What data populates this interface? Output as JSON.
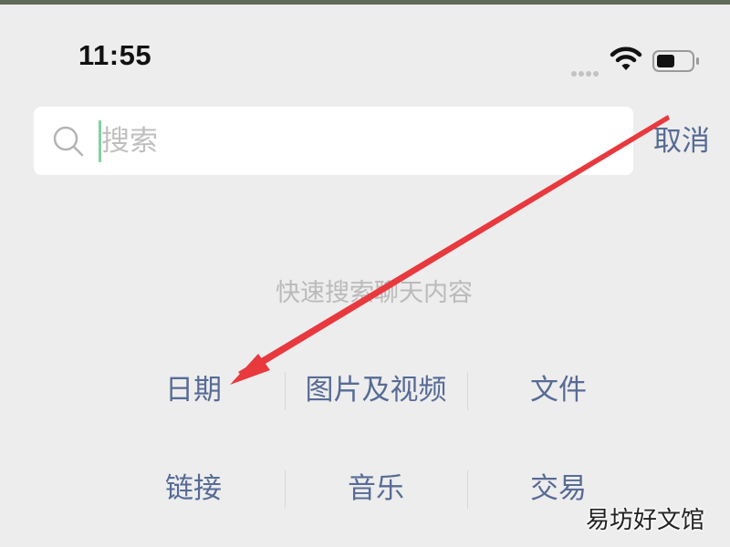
{
  "status_bar": {
    "time": "11:55",
    "icons": [
      "signal-dots-icon",
      "wifi-icon",
      "battery-icon"
    ]
  },
  "search": {
    "placeholder": "搜索",
    "value": "",
    "cancel_label": "取消"
  },
  "hint": "快速搜索聊天内容",
  "categories": [
    [
      "日期",
      "图片及视频",
      "文件"
    ],
    [
      "链接",
      "音乐",
      "交易"
    ]
  ],
  "watermark": "易坊好文馆",
  "colors": {
    "background": "#ededed",
    "link": "#576b95",
    "hint_text": "#bababa",
    "caret": "#7ed39d",
    "annotation_arrow": "#e8393e"
  }
}
